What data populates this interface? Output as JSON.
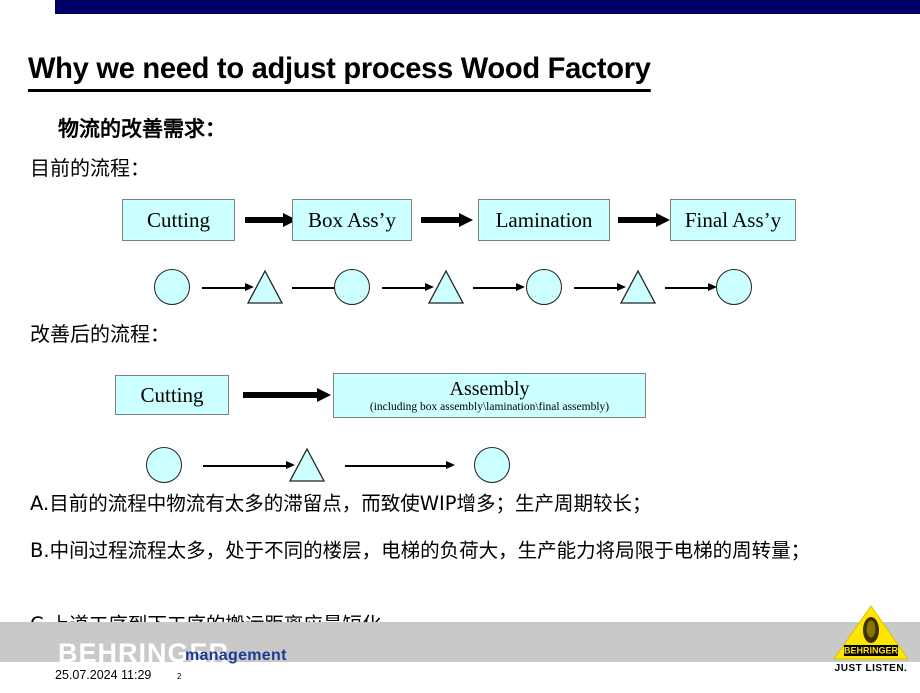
{
  "slide": {
    "title": "Why we need to adjust process Wood Factory",
    "subheading": "物流的改善需求：",
    "current_label": "目前的流程：",
    "improved_label": "改善后的流程："
  },
  "colors": {
    "topbar": "#000066",
    "box_fill": "#CCFFFF",
    "box_border": "#808080",
    "footer_band": "#c9c9c9",
    "brand_blue": "#1f3a93",
    "logo_yellow": "#FFE500"
  },
  "current_flow": {
    "boxes": [
      {
        "label": "Cutting"
      },
      {
        "label": "Box Ass’y"
      },
      {
        "label": "Lamination"
      },
      {
        "label": "Final Ass’y"
      }
    ],
    "shapes": [
      "circle",
      "triangle",
      "circle",
      "triangle",
      "circle",
      "triangle",
      "circle"
    ]
  },
  "improved_flow": {
    "boxes": [
      {
        "label": "Cutting",
        "sublabel": ""
      },
      {
        "label": "Assembly",
        "sublabel": "(including box assembly\\lamination\\final assembly)"
      }
    ],
    "shapes": [
      "circle",
      "triangle",
      "circle"
    ]
  },
  "bullets": [
    "A.目前的流程中物流有太多的滞留点，而致使WIP增多；生产周期较长；",
    "B.中间过程流程太多，处于不同的楼层，电梯的负荷大，生产能力将局限于电梯的周转量；",
    "C.上道工序到下工序的搬运距离应最短化。"
  ],
  "footer": {
    "brand": "BEHRINGER",
    "brand_sub": "management",
    "timestamp": "25.07.2024 11:29",
    "page_number": "2"
  },
  "logo": {
    "wordmark": "BEHRINGER",
    "tagline": "JUST LISTEN."
  }
}
